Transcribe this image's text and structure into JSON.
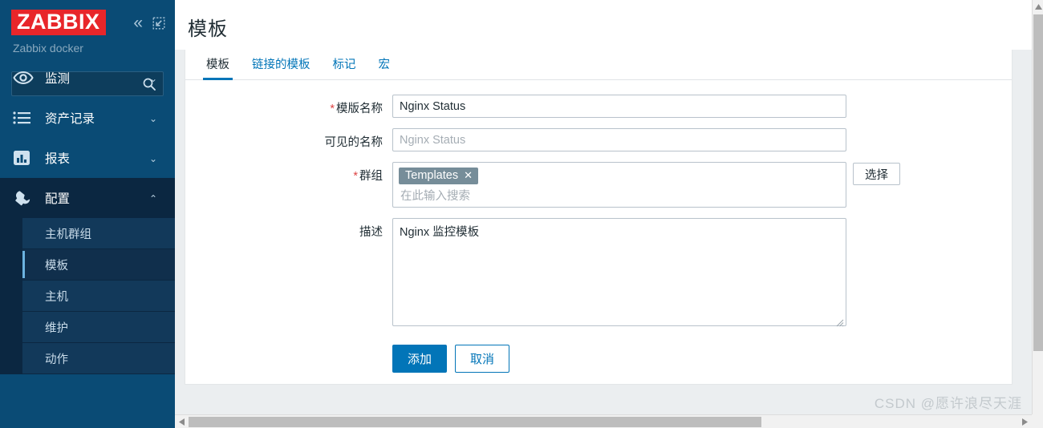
{
  "sidebar": {
    "logo": "ZABBIX",
    "collapse_icon": "chevron-double-left-icon",
    "expand_icon": "collapse-sidebar-icon",
    "user": "Zabbix docker",
    "search": {
      "value": "",
      "placeholder": "",
      "icon": "search-icon"
    },
    "nav": [
      {
        "label": "监测",
        "icon": "eye-icon",
        "arrow": "⌄",
        "active": false
      },
      {
        "label": "资产记录",
        "icon": "list-icon",
        "arrow": "⌄",
        "active": false
      },
      {
        "label": "报表",
        "icon": "bar-chart-icon",
        "arrow": "⌄",
        "active": false
      },
      {
        "label": "配置",
        "icon": "wrench-icon",
        "arrow": "⌃",
        "active": true
      }
    ],
    "submenu": [
      {
        "label": "主机群组",
        "selected": false
      },
      {
        "label": "模板",
        "selected": true
      },
      {
        "label": "主机",
        "selected": false
      },
      {
        "label": "维护",
        "selected": false
      },
      {
        "label": "动作",
        "selected": false
      }
    ]
  },
  "page": {
    "title": "模板",
    "tabs": [
      {
        "label": "模板",
        "active": true
      },
      {
        "label": "链接的模板",
        "active": false
      },
      {
        "label": "标记",
        "active": false
      },
      {
        "label": "宏",
        "active": false
      }
    ]
  },
  "form": {
    "template_name": {
      "label": "模版名称",
      "required": "*",
      "value": "Nginx Status",
      "placeholder": ""
    },
    "visible_name": {
      "label": "可见的名称",
      "required": "",
      "value": "",
      "placeholder": "Nginx Status"
    },
    "groups": {
      "label": "群组",
      "required": "*",
      "chips": [
        {
          "label": "Templates",
          "remove_icon": "close-icon"
        }
      ],
      "placeholder": "在此输入搜索",
      "select_button": "选择"
    },
    "description": {
      "label": "描述",
      "required": "",
      "value": "Nginx 监控模板",
      "placeholder": ""
    },
    "actions": {
      "submit": "添加",
      "cancel": "取消"
    }
  },
  "scrollbars": {
    "vertical": {
      "up_icon": "caret-up-icon",
      "down_icon": "caret-down-icon"
    },
    "horizontal": {
      "left_icon": "caret-left-icon",
      "right_icon": "caret-right-icon"
    }
  },
  "watermark": "CSDN @愿许浪尽天涯",
  "colors": {
    "sidebar_bg": "#0a4b75",
    "sidebar_active_bg": "#0b2741",
    "logo_red": "#e8262a",
    "accent_blue": "#0275b8",
    "chip_gray": "#768d99",
    "required_red": "#d44444"
  }
}
